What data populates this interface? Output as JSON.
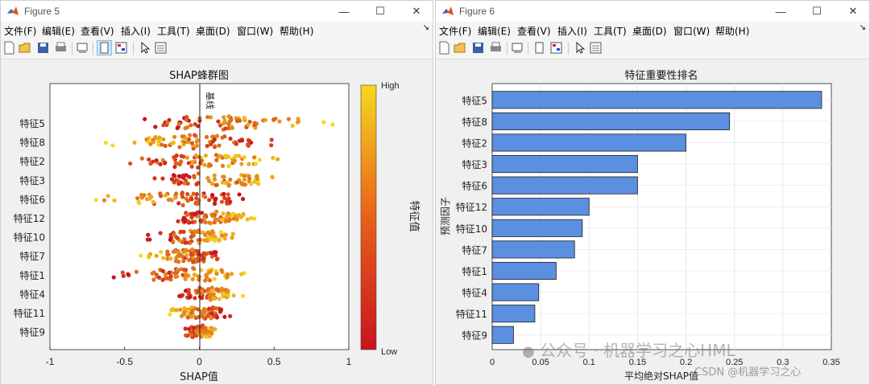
{
  "windows": [
    {
      "title": "Figure 5",
      "menu": [
        "文件(F)",
        "编辑(E)",
        "查看(V)",
        "插入(I)",
        "工具(T)",
        "桌面(D)",
        "窗口(W)",
        "帮助(H)"
      ]
    },
    {
      "title": "Figure 6",
      "menu": [
        "文件(F)",
        "编辑(E)",
        "查看(V)",
        "插入(I)",
        "工具(T)",
        "桌面(D)",
        "窗口(W)",
        "帮助(H)"
      ]
    }
  ],
  "watermarks": {
    "wechat": "公众号 · 机器学习之心HML",
    "csdn": "CSDN @机器学习之心"
  },
  "chart_data": [
    {
      "type": "scatter",
      "title": "SHAP蜂群图",
      "xlabel": "SHAP值",
      "ylabel": "",
      "xlim": [
        -1,
        1
      ],
      "xticks": [
        "-1",
        "-0.5",
        "0",
        "0.5",
        "1"
      ],
      "baseline_label": "基线",
      "features": [
        "特征5",
        "特征8",
        "特征2",
        "特征3",
        "特征6",
        "特征12",
        "特征10",
        "特征7",
        "特征1",
        "特征4",
        "特征11",
        "特征9"
      ],
      "spread": [
        [
          -0.48,
          1.0
        ],
        [
          -0.63,
          0.52
        ],
        [
          -0.6,
          0.55
        ],
        [
          -0.32,
          0.57
        ],
        [
          -0.77,
          0.3
        ],
        [
          -0.2,
          0.4
        ],
        [
          -0.35,
          0.25
        ],
        [
          -0.4,
          0.18
        ],
        [
          -0.58,
          0.35
        ],
        [
          -0.15,
          0.3
        ],
        [
          -0.2,
          0.22
        ],
        [
          -0.1,
          0.12
        ]
      ],
      "colorbar": {
        "label": "特征值",
        "high": "High",
        "low": "Low",
        "colors": [
          "#c8141e",
          "#f8d81e"
        ]
      }
    },
    {
      "type": "bar",
      "orientation": "horizontal",
      "title": "特征重要性排名",
      "xlabel": "平均绝对SHAP值",
      "ylabel": "预测因子",
      "categories": [
        "特征5",
        "特征8",
        "特征2",
        "特征3",
        "特征6",
        "特征12",
        "特征10",
        "特征7",
        "特征1",
        "特征4",
        "特征11",
        "特征9"
      ],
      "values": [
        0.34,
        0.245,
        0.2,
        0.15,
        0.15,
        0.1,
        0.093,
        0.085,
        0.066,
        0.048,
        0.044,
        0.022
      ],
      "xlim": [
        0,
        0.35
      ],
      "xticks": [
        "0",
        "0.05",
        "0.1",
        "0.15",
        "0.2",
        "0.25",
        "0.3",
        "0.35"
      ],
      "bar_color": "#5b8fe0",
      "grid": true
    }
  ]
}
